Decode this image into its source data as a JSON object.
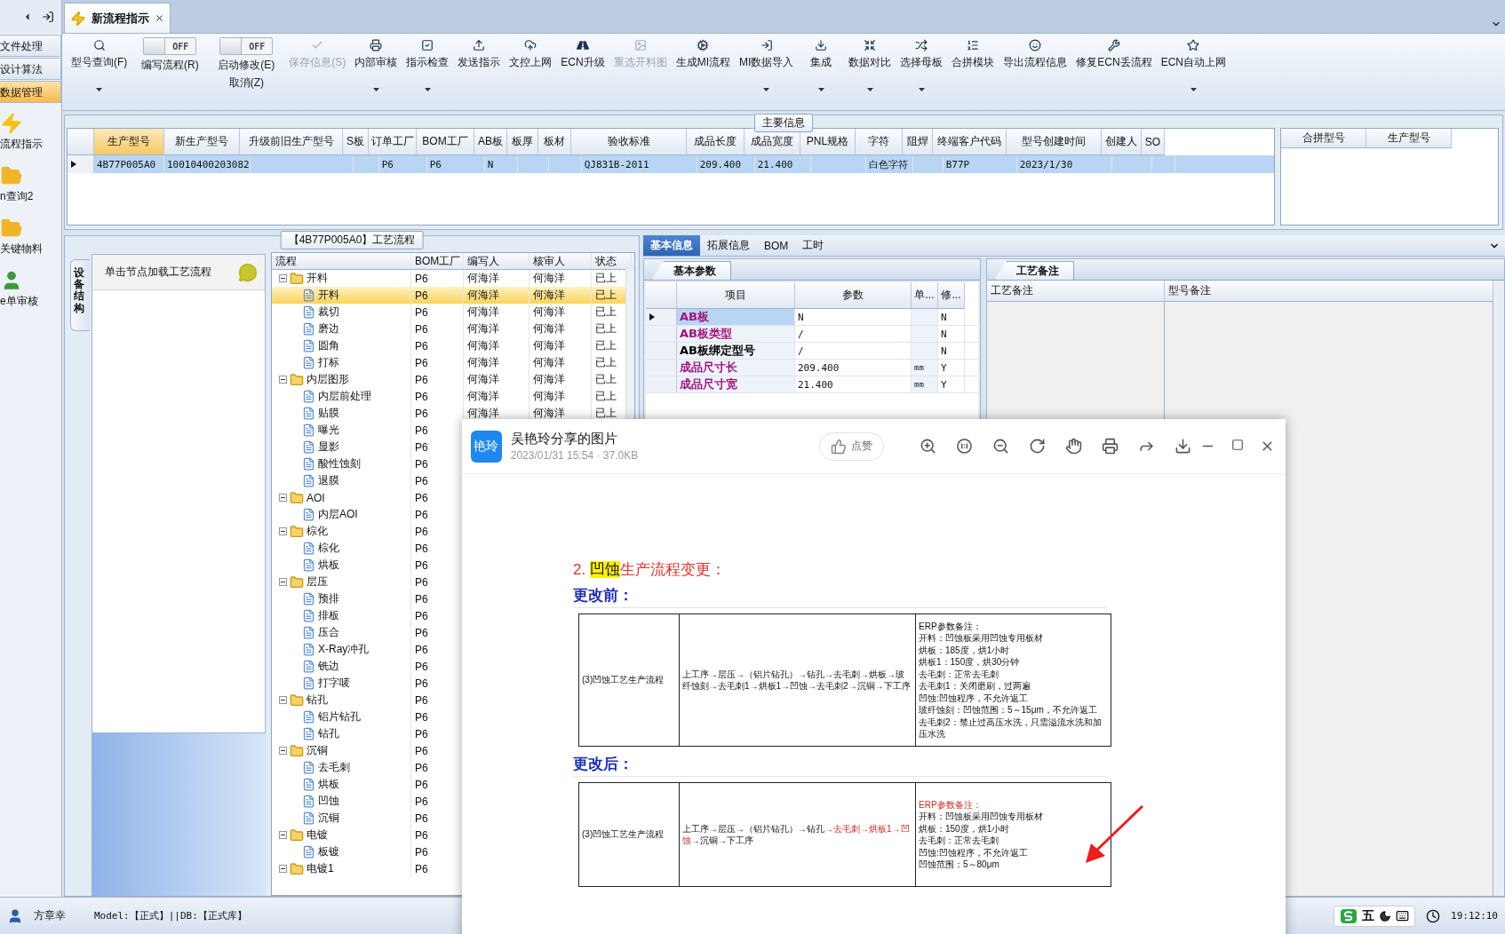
{
  "sidebar": {
    "nav": [
      {
        "label": "文件处理",
        "selected": false
      },
      {
        "label": "设计算法",
        "selected": false
      },
      {
        "label": "数据管理",
        "selected": true
      }
    ],
    "items": [
      {
        "label": "流程指示"
      },
      {
        "label": "n查询2"
      },
      {
        "label": "关键物料"
      },
      {
        "label": "e单审核"
      }
    ]
  },
  "tab": {
    "title": "新流程指示"
  },
  "ribbon": [
    {
      "kind": "button",
      "label": "型号查询(F)",
      "dropdown": true,
      "disabled": false
    },
    {
      "kind": "toggle",
      "label": "编写流程(R)",
      "on": false,
      "state_text": "OFF",
      "disabled": false
    },
    {
      "kind": "toggle",
      "label": "启动修改(E)",
      "sublabel": "取消(Z)",
      "on": false,
      "state_text": "OFF",
      "disabled": false
    },
    {
      "kind": "button",
      "label": "保存信息(S)",
      "dropdown": false,
      "disabled": true
    },
    {
      "kind": "button",
      "label": "内部审核",
      "dropdown": true,
      "disabled": false
    },
    {
      "kind": "button",
      "label": "指示检查",
      "dropdown": true,
      "disabled": false
    },
    {
      "kind": "button",
      "label": "发送指示",
      "dropdown": false,
      "disabled": false
    },
    {
      "kind": "button",
      "label": "文控上网",
      "dropdown": false,
      "disabled": false
    },
    {
      "kind": "button",
      "label": "ECN升级",
      "dropdown": false,
      "disabled": false
    },
    {
      "kind": "button",
      "label": "重选开料图",
      "dropdown": false,
      "disabled": true
    },
    {
      "kind": "button",
      "label": "生成MI流程",
      "dropdown": false,
      "disabled": false
    },
    {
      "kind": "button",
      "label": "MI数据导入",
      "dropdown": true,
      "disabled": false
    },
    {
      "kind": "button",
      "label": "集成",
      "dropdown": true,
      "disabled": false
    },
    {
      "kind": "button",
      "label": "数据对比",
      "dropdown": true,
      "disabled": false
    },
    {
      "kind": "button",
      "label": "选择母板",
      "dropdown": true,
      "disabled": false
    },
    {
      "kind": "button",
      "label": "合拼模块",
      "dropdown": false,
      "disabled": false
    },
    {
      "kind": "button",
      "label": "导出流程信息",
      "dropdown": false,
      "disabled": false
    },
    {
      "kind": "button",
      "label": "修复ECN丢流程",
      "dropdown": false,
      "disabled": false
    },
    {
      "kind": "button",
      "label": "ECN自动上网",
      "dropdown": true,
      "disabled": false
    }
  ],
  "main_info": {
    "title": "主要信息",
    "columns": [
      {
        "label": "生产型号",
        "selected": true
      },
      {
        "label": "新生产型号",
        "selected": false
      },
      {
        "label": "升级前旧生产型号",
        "selected": false
      },
      {
        "label": "S板",
        "selected": false
      },
      {
        "label": "订单工厂",
        "selected": false
      },
      {
        "label": "BOM工厂",
        "selected": false
      },
      {
        "label": "AB板",
        "selected": false
      },
      {
        "label": "板厚",
        "selected": false
      },
      {
        "label": "板材",
        "selected": false
      },
      {
        "label": "验收标准",
        "selected": false
      },
      {
        "label": "成品长度",
        "selected": false
      },
      {
        "label": "成品宽度",
        "selected": false
      },
      {
        "label": "PNL规格",
        "selected": false
      },
      {
        "label": "字符",
        "selected": false
      },
      {
        "label": "阻焊",
        "selected": false
      },
      {
        "label": "终端客户代码",
        "selected": false
      },
      {
        "label": "型号创建时间",
        "selected": false
      },
      {
        "label": "创建人",
        "selected": false
      },
      {
        "label": "SO",
        "selected": false
      }
    ],
    "rows": [
      {
        "selected": true,
        "cells": [
          "4B77P005A0",
          "10010400203082",
          null,
          null,
          "P6",
          "P6",
          "N",
          null,
          null,
          "QJ831B-2011",
          "209.400",
          "21.400",
          null,
          "白色字符",
          null,
          "B77P",
          "2023/1/30",
          null,
          null
        ]
      }
    ],
    "side_columns": [
      "合拼型号",
      "生产型号"
    ]
  },
  "flow": {
    "title": "【4B77P005A0】工艺流程",
    "side_tab": "设备结构",
    "hint": "单击节点加载工艺流程",
    "columns": [
      "流程",
      "BOM工厂",
      "编写人",
      "核审人",
      "状态"
    ],
    "nodes": [
      {
        "label": "开料",
        "bom": "P6",
        "writer": "何海洋",
        "reviewer": "何海洋",
        "status": "已上",
        "selected": false,
        "expanded": true,
        "children": [
          {
            "label": "开料",
            "bom": "P6",
            "writer": "何海洋",
            "reviewer": "何海洋",
            "status": "已上",
            "selected": true
          },
          {
            "label": "裁切",
            "bom": "P6",
            "writer": "何海洋",
            "reviewer": "何海洋",
            "status": "已上",
            "selected": false
          },
          {
            "label": "磨边",
            "bom": "P6",
            "writer": "何海洋",
            "reviewer": "何海洋",
            "status": "已上",
            "selected": false
          },
          {
            "label": "圆角",
            "bom": "P6",
            "writer": "何海洋",
            "reviewer": "何海洋",
            "status": "已上",
            "selected": false
          },
          {
            "label": "打标",
            "bom": "P6",
            "writer": "何海洋",
            "reviewer": "何海洋",
            "status": "已上",
            "selected": false
          }
        ]
      },
      {
        "label": "内层图形",
        "bom": "P6",
        "writer": "何海洋",
        "reviewer": "何海洋",
        "status": "已上",
        "selected": false,
        "expanded": true,
        "children": [
          {
            "label": "内层前处理",
            "bom": "P6",
            "writer": "何海洋",
            "reviewer": "何海洋",
            "status": "已上",
            "selected": false
          },
          {
            "label": "贴膜",
            "bom": "P6",
            "writer": "何海洋",
            "reviewer": "何海洋",
            "status": "已上",
            "selected": false
          },
          {
            "label": "曝光",
            "bom": "P6",
            "selected": false
          },
          {
            "label": "显影",
            "bom": "P6",
            "selected": false
          },
          {
            "label": "酸性蚀刻",
            "bom": "P6",
            "selected": false
          },
          {
            "label": "退膜",
            "bom": "P6",
            "selected": false
          }
        ]
      },
      {
        "label": "AOI",
        "bom": "P6",
        "selected": false,
        "expanded": true,
        "children": [
          {
            "label": "内层AOI",
            "bom": "P6",
            "selected": false
          }
        ]
      },
      {
        "label": "棕化",
        "bom": "P6",
        "selected": false,
        "expanded": true,
        "children": [
          {
            "label": "棕化",
            "bom": "P6",
            "selected": false
          },
          {
            "label": "烘板",
            "bom": "P6",
            "selected": false
          }
        ]
      },
      {
        "label": "层压",
        "bom": "P6",
        "selected": false,
        "expanded": true,
        "children": [
          {
            "label": "预排",
            "bom": "P6",
            "selected": false
          },
          {
            "label": "排板",
            "bom": "P6",
            "selected": false
          },
          {
            "label": "压合",
            "bom": "P6",
            "selected": false
          },
          {
            "label": "X-Ray冲孔",
            "bom": "P6",
            "selected": false
          },
          {
            "label": "铣边",
            "bom": "P6",
            "selected": false
          },
          {
            "label": "打字唛",
            "bom": "P6",
            "selected": false
          }
        ]
      },
      {
        "label": "钻孔",
        "bom": "P6",
        "selected": false,
        "expanded": true,
        "children": [
          {
            "label": "铝片钻孔",
            "bom": "P6",
            "selected": false
          },
          {
            "label": "钻孔",
            "bom": "P6",
            "selected": false
          }
        ]
      },
      {
        "label": "沉铜",
        "bom": "P6",
        "selected": false,
        "expanded": true,
        "children": [
          {
            "label": "去毛刺",
            "bom": "P6",
            "selected": false
          },
          {
            "label": "烘板",
            "bom": "P6",
            "selected": false
          },
          {
            "label": "凹蚀",
            "bom": "P6",
            "selected": false
          },
          {
            "label": "沉铜",
            "bom": "P6",
            "selected": false
          }
        ]
      },
      {
        "label": "电镀",
        "bom": "P6",
        "selected": false,
        "expanded": true,
        "children": [
          {
            "label": "板镀",
            "bom": "P6",
            "selected": false
          }
        ]
      },
      {
        "label": "电镀1",
        "bom": "P6",
        "selected": false,
        "expanded": true
      }
    ]
  },
  "detail": {
    "tabs": [
      {
        "label": "基本信息",
        "selected": true
      },
      {
        "label": "拓展信息",
        "selected": false
      },
      {
        "label": "BOM",
        "selected": false
      },
      {
        "label": "工时",
        "selected": false
      }
    ],
    "params": {
      "tab": "基本参数",
      "columns": [
        "项目",
        "参数",
        "单...",
        "修..."
      ],
      "rows": [
        {
          "item": "AB板",
          "color": "#a0147f",
          "value": "N",
          "modified": "N",
          "selected": true
        },
        {
          "item": "AB板类型",
          "color": "#a0147f",
          "value": "/",
          "modified": "N",
          "selected": false
        },
        {
          "item": "AB板绑定型号",
          "color": "#000000",
          "value": "/",
          "modified": "N",
          "selected": false
        },
        {
          "item": "成品尺寸长",
          "color": "#a0147f",
          "value": "209.400",
          "unit": "mm",
          "modified": "Y",
          "selected": false
        },
        {
          "item": "成品尺寸宽",
          "color": "#a0147f",
          "value": "21.400",
          "unit": "mm",
          "modified": "Y",
          "selected": false
        }
      ]
    },
    "notes": {
      "tab": "工艺备注",
      "columns": [
        "工艺备注",
        "型号备注"
      ]
    }
  },
  "viewer": {
    "avatar": "艳玲",
    "title": "吴艳玲分享的图片",
    "subtitle": "2023/01/31 15:54 · 37.0KB",
    "like": "点赞",
    "document": {
      "heading": {
        "number": "2.",
        "highlight": "凹蚀",
        "rest": "生产流程变更："
      },
      "sections": [
        {
          "title": "更改前：",
          "process": "(3)凹蚀工艺生产流程",
          "flow": [
            {
              "text": "上工序→层压→（铝片钻孔）→钻孔→去毛刺→烘板→玻纤蚀刻→去毛刺1→烘板1→凹蚀→去毛刺2→沉铜→下工序",
              "red": false
            }
          ],
          "notes": [
            {
              "text": "ERP参数备注：",
              "red": false
            },
            {
              "text": "开料：凹蚀板采用凹蚀专用板材",
              "red": false
            },
            {
              "text": "烘板：185度，烘1小时",
              "red": false
            },
            {
              "text": "烘板1：150度，烘30分钟",
              "red": false
            },
            {
              "text": "去毛刺：正常去毛刺",
              "red": false
            },
            {
              "text": "去毛刺1：关闭磨刷，过两遍",
              "red": false
            },
            {
              "text": "凹蚀:凹蚀程序，不允许返工",
              "red": false
            },
            {
              "text": "玻纤蚀刻：凹蚀范围：5～15μm，不允许返工",
              "red": false
            },
            {
              "text": "去毛刺2：禁止过高压水洗，只需溢流水洗和加压水洗",
              "red": false
            }
          ]
        },
        {
          "title": "更改后：",
          "process": "(3)凹蚀工艺生产流程",
          "flow": [
            {
              "text": "上工序→层压→（铝片钻孔）→钻孔",
              "red": false
            },
            {
              "text": "→去毛刺→烘板1→凹蚀",
              "red": true
            },
            {
              "text": "→沉铜→下工序",
              "red": false
            }
          ],
          "notes": [
            {
              "text": "ERP参数备注：",
              "red": true
            },
            {
              "text": "开料：凹蚀板采用凹蚀专用板材",
              "red": false
            },
            {
              "text": "烘板：150度，烘1小时",
              "red": false
            },
            {
              "text": "去毛刺：正常去毛刺",
              "red": false
            },
            {
              "text": "凹蚀:凹蚀程序，不允许返工",
              "red": false
            },
            {
              "text": "凹蚀范围：5～80μm",
              "red": false
            }
          ]
        }
      ]
    }
  },
  "status_bar": {
    "user": "方章幸",
    "env": "Model:【正式】||DB:【正式库】",
    "ime": "五",
    "time": "19:12:10"
  }
}
